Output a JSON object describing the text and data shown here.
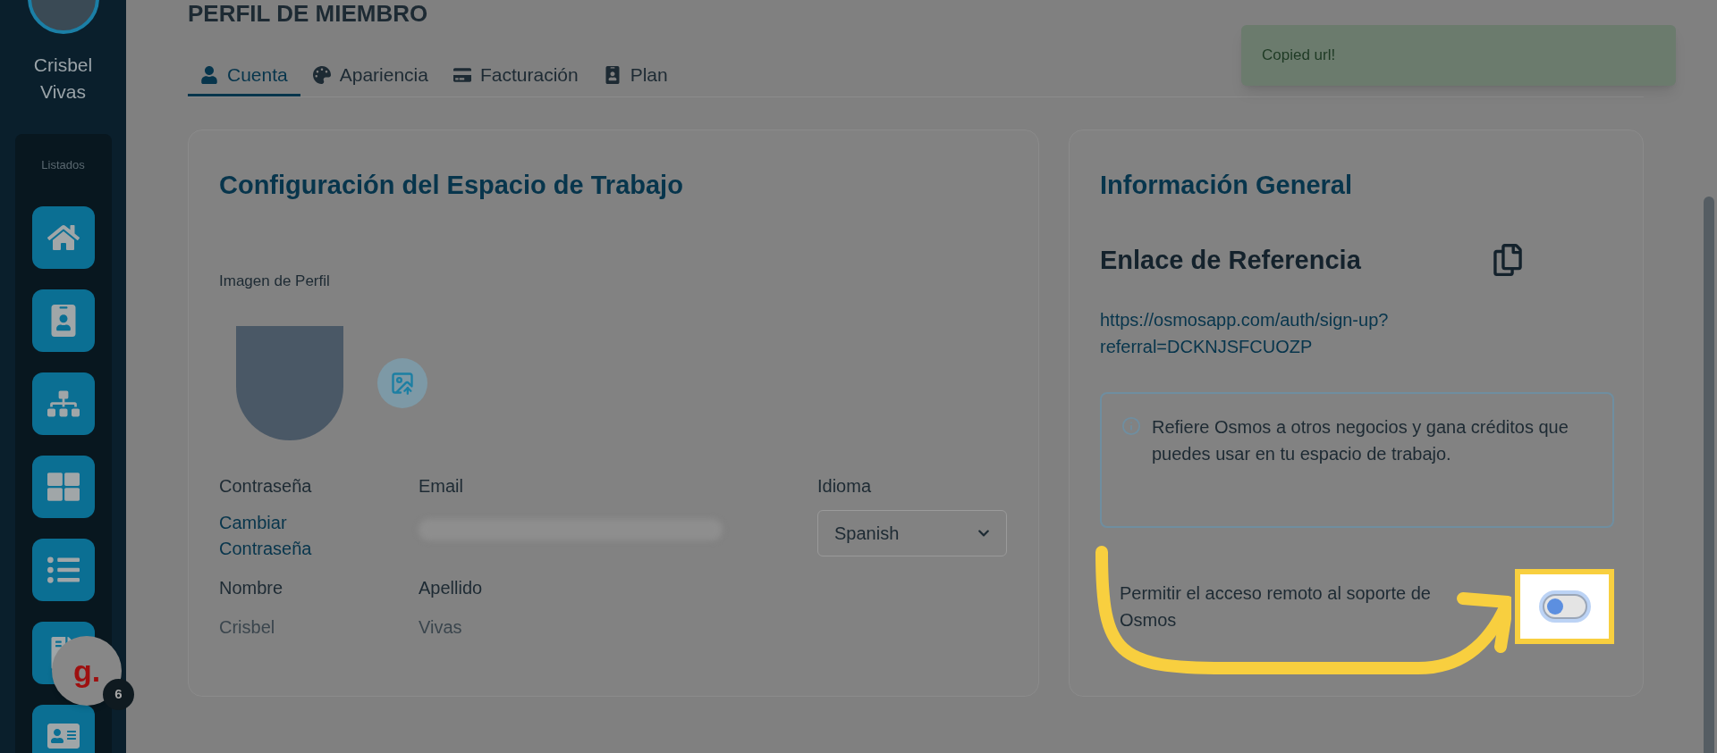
{
  "page_title": "PERFIL DE MIEMBRO",
  "sidebar": {
    "user_name": "Crisbel Vivas",
    "section_label": "Listados"
  },
  "tabs": [
    {
      "label": "Cuenta",
      "selected": true
    },
    {
      "label": "Apariencia",
      "selected": false
    },
    {
      "label": "Facturación",
      "selected": false
    },
    {
      "label": "Plan",
      "selected": false
    }
  ],
  "workspace_card": {
    "title": "Configuración del Espacio de Trabajo",
    "profile_image_label": "Imagen de Perfil",
    "password": {
      "label": "Contraseña",
      "link": "Cambiar Contraseña"
    },
    "email": {
      "label": "Email"
    },
    "language": {
      "label": "Idioma",
      "value": "Spanish"
    },
    "first_name": {
      "label": "Nombre",
      "value": "Crisbel"
    },
    "last_name": {
      "label": "Apellido",
      "value": "Vivas"
    }
  },
  "info_card": {
    "title": "Información General",
    "referral_title": "Enlace de Referencia",
    "referral_url": "https://osmosapp.com/auth/sign-up?referral=DCKNJSFCUOZP",
    "notice": "Refiere Osmos a otros negocios y gana créditos que puedes usar en tu espacio de trabajo.",
    "remote_access": {
      "label": "Permitir el acceso remoto al soporte de Osmos",
      "on": false
    }
  },
  "toast": {
    "message": "Copied url!"
  },
  "help_bubble": {
    "logo": "g.",
    "badge": "6"
  }
}
